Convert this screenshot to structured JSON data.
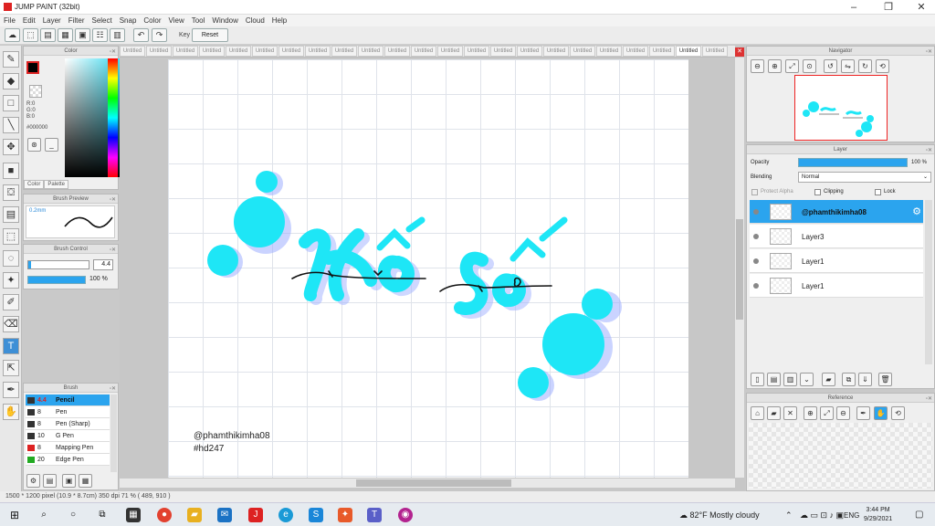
{
  "title": "JUMP PAINT (32bit)",
  "menu": [
    "File",
    "Edit",
    "Layer",
    "Filter",
    "Select",
    "Snap",
    "Color",
    "View",
    "Tool",
    "Window",
    "Cloud",
    "Help"
  ],
  "toolbar": {
    "key_label": "Key",
    "reset_label": "Reset"
  },
  "color_panel": {
    "title": "Color",
    "r": "R:0",
    "g": "G:0",
    "b": "B:0",
    "hex": "#000000",
    "tab_color": "Color",
    "tab_palette": "Palette",
    "fg": "#000000",
    "accent": "#27d6ee"
  },
  "brush_preview": {
    "title": "Brush Preview",
    "size": "0.2mm"
  },
  "brush_control": {
    "title": "Brush Control",
    "size": "4.4",
    "opacity": "100 %"
  },
  "brush_panel": {
    "title": "Brush",
    "items": [
      {
        "num": "4.4",
        "name": "Pencil",
        "selected": true
      },
      {
        "num": "8",
        "name": "Pen"
      },
      {
        "num": "8",
        "name": "Pen (Sharp)"
      },
      {
        "num": "10",
        "name": "G Pen"
      },
      {
        "num": "8",
        "name": "Mapping Pen"
      },
      {
        "num": "20",
        "name": "Edge Pen"
      }
    ]
  },
  "doc_tabs": {
    "tab": "Untitled",
    "count": 23,
    "current_index": 21
  },
  "canvas": {
    "handle": "@phamthikimha08",
    "tag": "#hd247",
    "art_color": "#1ee6f6"
  },
  "navigator": {
    "title": "Navigator"
  },
  "layer_panel": {
    "title": "Layer",
    "opacity_label": "Opacity",
    "opacity_value": "100 %",
    "blending_label": "Blending",
    "blending_value": "Normal",
    "protect_alpha": "Protect Alpha",
    "clipping": "Clipping",
    "lock": "Lock",
    "layers": [
      {
        "name": "@phamthikimha08",
        "selected": true
      },
      {
        "name": "Layer3"
      },
      {
        "name": "Layer1"
      },
      {
        "name": "Layer1"
      }
    ]
  },
  "reference": {
    "title": "Reference"
  },
  "status": "1500 * 1200 pixel   (10.9 * 8.7cm)   350 dpi   71 %   ( 489, 910 )",
  "taskbar": {
    "weather": "82°F  Mostly cloudy",
    "lang": "ENG",
    "time": "3:44 PM",
    "date": "9/29/2021"
  }
}
